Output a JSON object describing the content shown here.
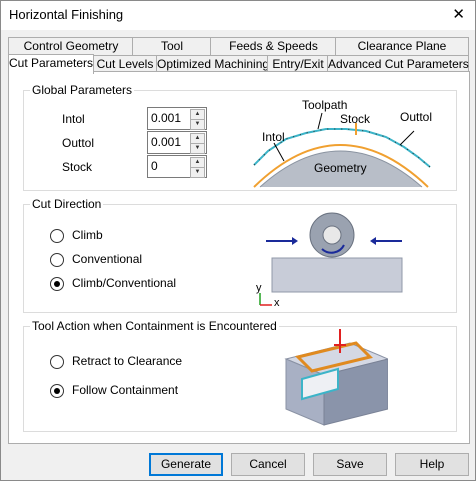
{
  "window": {
    "title": "Horizontal Finishing",
    "close_glyph": "✕"
  },
  "tabs_row1": [
    "Control Geometry",
    "Tool",
    "Feeds & Speeds",
    "Clearance Plane"
  ],
  "tabs_row2": [
    "Cut Parameters",
    "Cut Levels",
    "Optimized Machining",
    "Entry/Exit",
    "Advanced Cut Parameters"
  ],
  "active_tab": "Cut Parameters",
  "global": {
    "title": "Global Parameters",
    "intol_label": "Intol",
    "intol_value": "0.001",
    "outtol_label": "Outtol",
    "outtol_value": "0.001",
    "stock_label": "Stock",
    "stock_value": "0",
    "diagram": {
      "toolpath": "Toolpath",
      "stock": "Stock",
      "outtol": "Outtol",
      "intol": "Intol",
      "geometry": "Geometry"
    }
  },
  "cut_direction": {
    "title": "Cut Direction",
    "options": [
      "Climb",
      "Conventional",
      "Climb/Conventional"
    ],
    "selected": "Climb/Conventional",
    "axis_y": "y",
    "axis_x": "x"
  },
  "containment": {
    "title": "Tool Action when Containment is Encountered",
    "options": [
      "Retract to Clearance",
      "Follow Containment"
    ],
    "selected": "Follow Containment"
  },
  "buttons": {
    "generate": "Generate",
    "cancel": "Cancel",
    "save": "Save",
    "help": "Help"
  },
  "colors": {
    "accent": "#0078d7",
    "toolpath": "#3cb4c8",
    "stock": "#f0a030",
    "geometry": "#b8bec8",
    "arrow": "#1a2a9a",
    "containment": "#e08a20",
    "tool_marker": "#e02020"
  }
}
